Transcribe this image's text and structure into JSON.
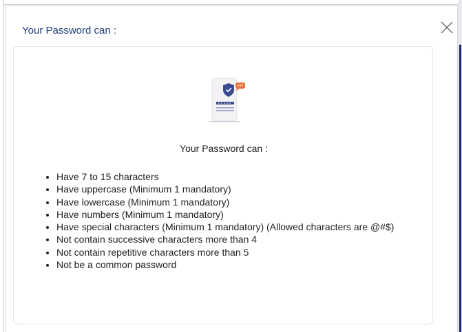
{
  "modal": {
    "title": "Your Password can :",
    "close_icon": "close-icon"
  },
  "card": {
    "illustration_icon": "password-shield-icon",
    "heading": "Your Password can :",
    "rules": [
      "Have 7 to 15 characters",
      "Have uppercase (Minimum 1 mandatory)",
      "Have lowercase (Minimum 1 mandatory)",
      "Have numbers (Minimum 1 mandatory)",
      "Have special characters (Minimum 1 mandatory) (Allowed characters are @#$)",
      "Not contain successive characters more than 4",
      "Not contain repetitive characters more than 5",
      "Not be a common password"
    ]
  },
  "colors": {
    "title": "#1d3f7a",
    "text": "#222222",
    "accent_orange": "#f0743e",
    "shield_navy": "#3b4a8c"
  }
}
